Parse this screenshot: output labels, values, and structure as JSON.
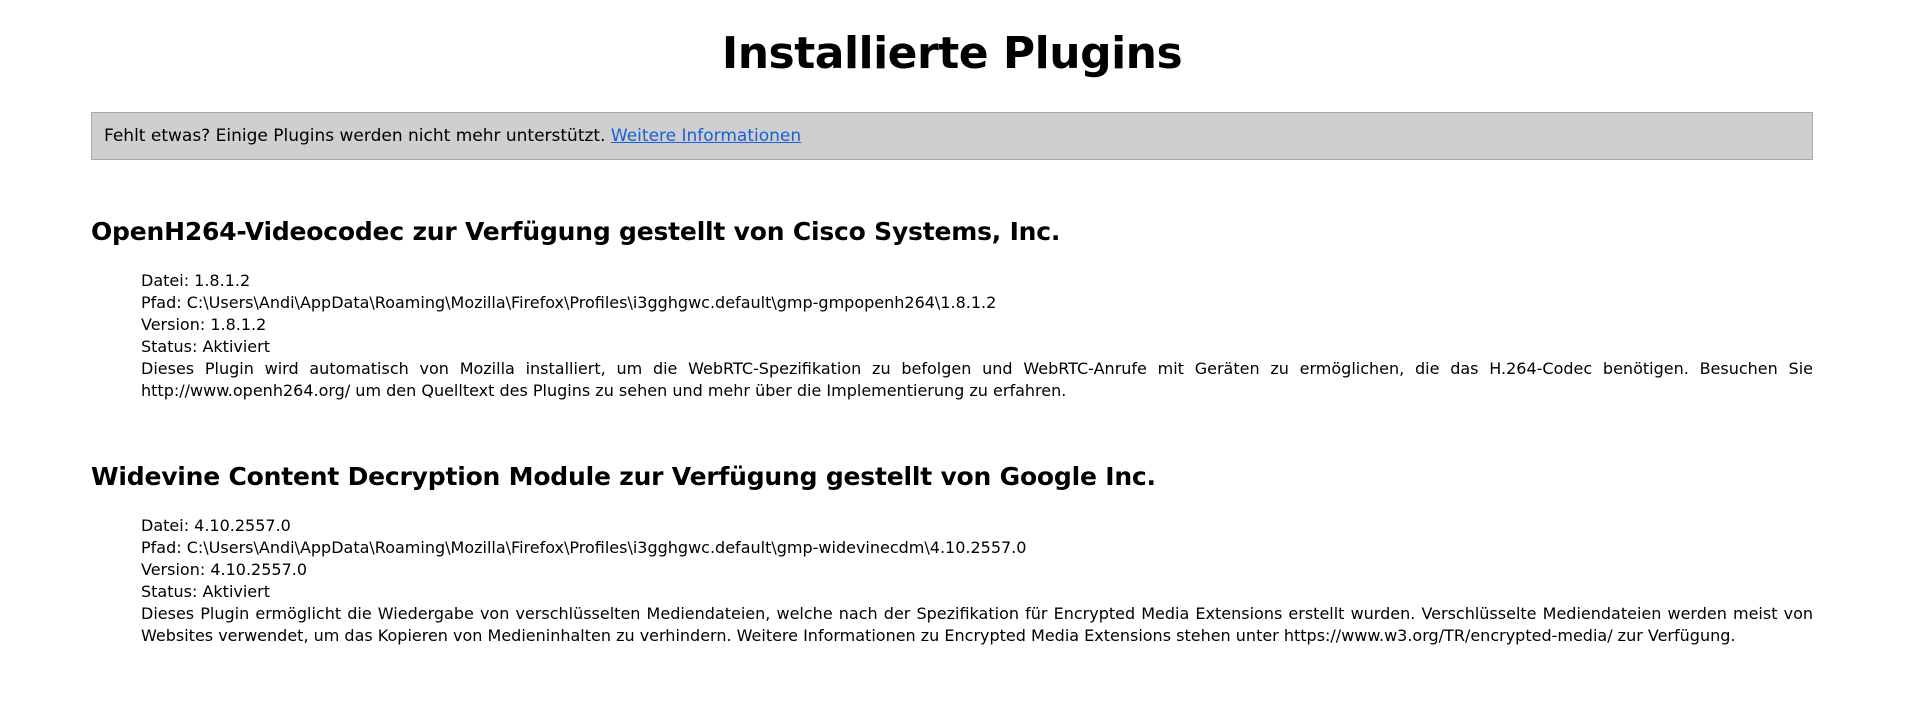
{
  "page": {
    "title": "Installierte Plugins"
  },
  "notice": {
    "text": "Fehlt etwas? Einige Plugins werden nicht mehr unterstützt.",
    "link_label": "Weitere Informationen"
  },
  "plugins": [
    {
      "heading": "OpenH264-Videocodec zur Verfügung gestellt von Cisco Systems, Inc.",
      "file": "Datei: 1.8.1.2",
      "path": "Pfad: C:\\Users\\Andi\\AppData\\Roaming\\Mozilla\\Firefox\\Profiles\\i3gghgwc.default\\gmp-gmpopenh264\\1.8.1.2",
      "version": "Version: 1.8.1.2",
      "status": "Status: Aktiviert",
      "description": "Dieses Plugin wird automatisch von Mozilla installiert, um die WebRTC-Spezifikation zu befolgen und WebRTC-Anrufe mit Geräten zu ermöglichen, die das H.264-Codec benötigen. Besuchen Sie http://www.openh264.org/ um den Quelltext des Plugins zu sehen und mehr über die Implementierung zu erfahren."
    },
    {
      "heading": "Widevine Content Decryption Module zur Verfügung gestellt von Google Inc.",
      "file": "Datei: 4.10.2557.0",
      "path": "Pfad: C:\\Users\\Andi\\AppData\\Roaming\\Mozilla\\Firefox\\Profiles\\i3gghgwc.default\\gmp-widevinecdm\\4.10.2557.0",
      "version": "Version: 4.10.2557.0",
      "status": "Status: Aktiviert",
      "description": "Dieses Plugin ermöglicht die Wiedergabe von verschlüsselten Mediendateien, welche nach der Spezifikation für Encrypted Media Extensions erstellt wurden. Verschlüsselte Mediendateien werden meist von Websites verwendet, um das Kopieren von Medieninhalten zu verhindern. Weitere Informationen zu Encrypted Media Extensions stehen unter https://www.w3.org/TR/encrypted-media/ zur Verfügung."
    }
  ]
}
